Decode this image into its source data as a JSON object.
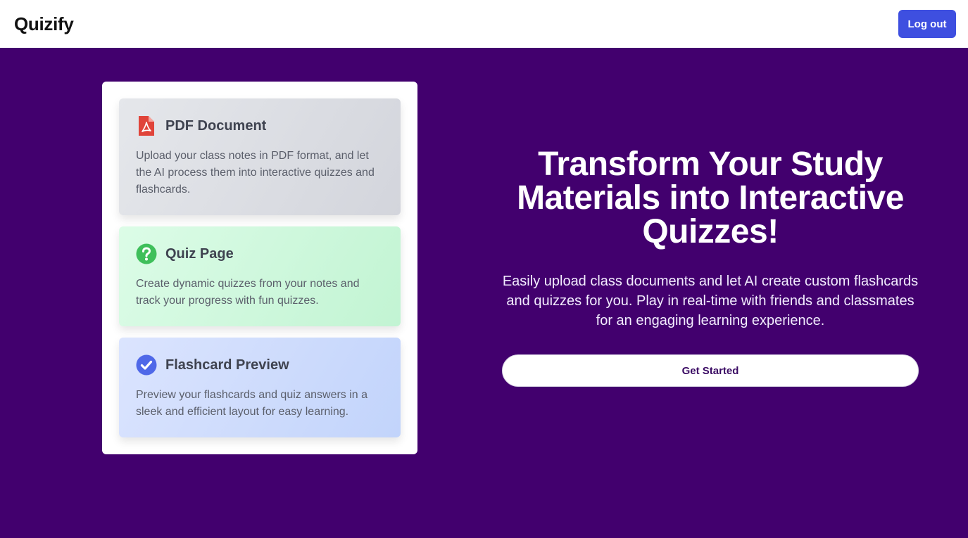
{
  "navbar": {
    "brand": "Quizify",
    "logout_label": "Log out"
  },
  "colors": {
    "brand_purple": "#42006e",
    "button_blue": "#3e4fe0",
    "pdf_red": "#e0443a",
    "quiz_green": "#3fbf5b",
    "flash_blue": "#4f68e8"
  },
  "features": [
    {
      "icon": "pdf-file-icon",
      "title": "PDF Document",
      "description": "Upload your class notes in PDF format, and let the AI process them into interactive quizzes and flashcards."
    },
    {
      "icon": "question-circle-icon",
      "title": "Quiz Page",
      "description": "Create dynamic quizzes from your notes and track your progress with fun quizzes."
    },
    {
      "icon": "check-circle-icon",
      "title": "Flashcard Preview",
      "description": "Preview your flashcards and quiz answers in a sleek and efficient layout for easy learning."
    }
  ],
  "hero": {
    "title": "Transform Your Study Materials into Interactive Quizzes!",
    "subtitle": "Easily upload class documents and let AI create custom flashcards and quizzes for you. Play in real-time with friends and classmates for an engaging learning experience.",
    "cta_label": "Get Started"
  }
}
